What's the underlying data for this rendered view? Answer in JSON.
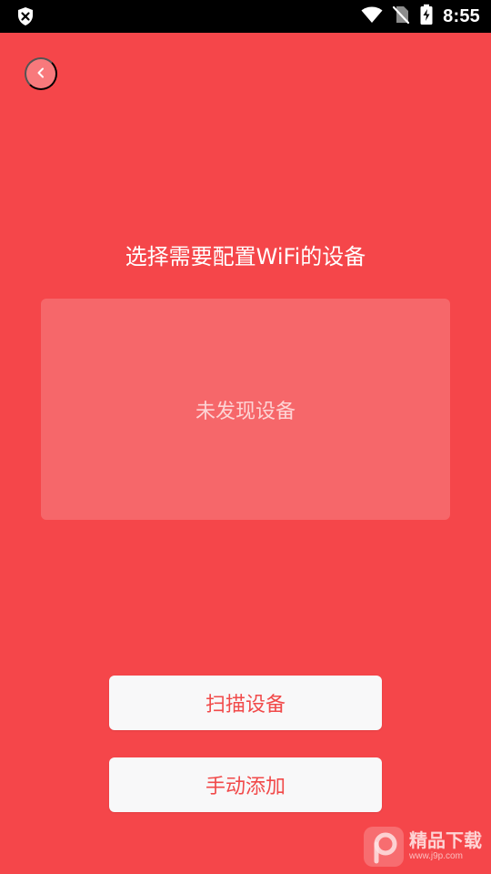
{
  "status_bar": {
    "time": "8:55",
    "icons": [
      "shield-x-icon",
      "wifi-icon",
      "no-sim-icon",
      "battery-charging-icon"
    ]
  },
  "header": {
    "back_icon": "chevron-left-icon"
  },
  "main": {
    "title": "选择需要配置WiFi的设备",
    "empty_state": "未发现设备"
  },
  "actions": {
    "scan_label": "扫描设备",
    "manual_label": "手动添加"
  },
  "watermark": {
    "main": "精品下载",
    "sub": "www.j9p.com"
  },
  "colors": {
    "background": "#f5464a",
    "button_bg": "#f8f8f9",
    "button_text": "#f14a4a"
  }
}
